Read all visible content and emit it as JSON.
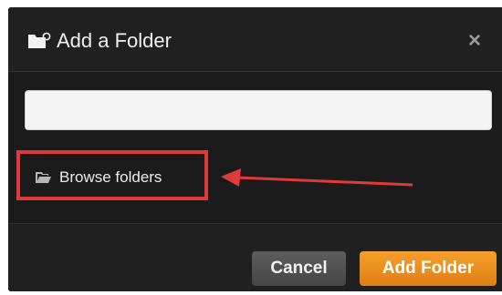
{
  "dialog": {
    "title": "Add a Folder",
    "title_icon": "folder-plus-icon",
    "close_symbol": "×",
    "path_input": {
      "value": "",
      "placeholder": ""
    },
    "browse_label": "Browse folders",
    "browse_icon": "folder-open-icon",
    "annotation": {
      "highlight_color": "#e03a3e",
      "arrow_color": "#e03a3e"
    },
    "buttons": {
      "cancel_label": "Cancel",
      "add_label": "Add Folder"
    },
    "colors": {
      "accent": "#f0901c",
      "background": "#1d1d1d"
    }
  }
}
